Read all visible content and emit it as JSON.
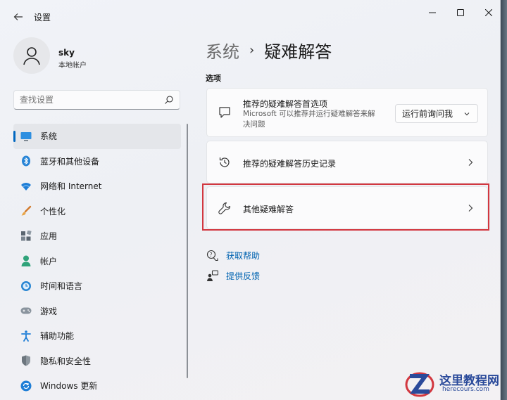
{
  "window": {
    "title": "设置",
    "back_icon": "arrow-left-icon",
    "controls": {
      "minimize": "—",
      "maximize": "☐",
      "close": "✕"
    }
  },
  "profile": {
    "name": "sky",
    "account_type": "本地帐户"
  },
  "search": {
    "placeholder": "查找设置"
  },
  "sidebar": {
    "items": [
      {
        "label": "系统",
        "icon": "monitor-icon",
        "active": true
      },
      {
        "label": "蓝牙和其他设备",
        "icon": "bluetooth-icon"
      },
      {
        "label": "网络和 Internet",
        "icon": "wifi-icon"
      },
      {
        "label": "个性化",
        "icon": "brush-icon"
      },
      {
        "label": "应用",
        "icon": "apps-icon"
      },
      {
        "label": "帐户",
        "icon": "person-icon"
      },
      {
        "label": "时间和语言",
        "icon": "clock-globe-icon"
      },
      {
        "label": "游戏",
        "icon": "gamepad-icon"
      },
      {
        "label": "辅助功能",
        "icon": "accessibility-icon"
      },
      {
        "label": "隐私和安全性",
        "icon": "shield-icon"
      },
      {
        "label": "Windows 更新",
        "icon": "update-icon"
      }
    ]
  },
  "main": {
    "breadcrumb": {
      "parent": "系统",
      "separator": "›",
      "current": "疑难解答"
    },
    "section_label": "选项",
    "cards": [
      {
        "title": "推荐的疑难解答首选项",
        "description": "Microsoft 可以推荐并运行疑难解答来解决问题",
        "icon": "chat-bubble-icon",
        "dropdown_value": "运行前询问我"
      },
      {
        "title": "推荐的疑难解答历史记录",
        "icon": "history-icon"
      },
      {
        "title": "其他疑难解答",
        "icon": "wrench-icon",
        "highlighted": true
      }
    ],
    "links": [
      {
        "label": "获取帮助",
        "icon": "help-chat-icon"
      },
      {
        "label": "提供反馈",
        "icon": "feedback-icon"
      }
    ]
  },
  "colors": {
    "accent": "#0067c0",
    "link": "#0063b1",
    "highlight_border": "#d2373f"
  },
  "watermark": {
    "title": "这里教程网",
    "subtitle": "herecours.com"
  }
}
